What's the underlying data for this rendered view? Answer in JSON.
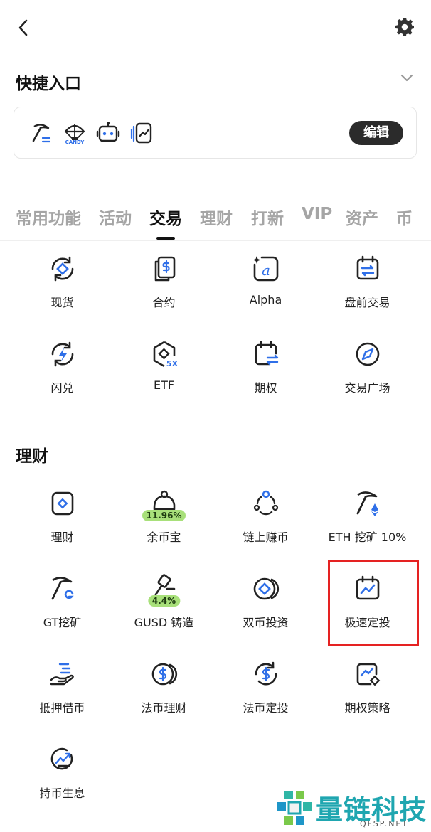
{
  "header": {
    "back_icon": "chevron-left-icon",
    "settings_icon": "gear-icon"
  },
  "quick_entry": {
    "title": "快捷入口",
    "icons": [
      "pickaxe-icon",
      "candy-parachute-icon",
      "robot-icon",
      "copy-trade-icon"
    ],
    "candy_label": "CANDY",
    "edit_label": "编辑"
  },
  "tabs": [
    {
      "label": "常用功能",
      "active": false
    },
    {
      "label": "活动",
      "active": false
    },
    {
      "label": "交易",
      "active": true
    },
    {
      "label": "理财",
      "active": false
    },
    {
      "label": "打新",
      "active": false
    },
    {
      "label": "VIP",
      "active": false
    },
    {
      "label": "资产",
      "active": false
    },
    {
      "label": "币",
      "active": false
    }
  ],
  "trade": {
    "items": [
      {
        "label": "现货",
        "icon": "spot-icon"
      },
      {
        "label": "合约",
        "icon": "futures-icon"
      },
      {
        "label": "Alpha",
        "icon": "alpha-icon"
      },
      {
        "label": "盘前交易",
        "icon": "premarket-icon"
      },
      {
        "label": "闪兑",
        "icon": "flash-swap-icon"
      },
      {
        "label": "ETF",
        "icon": "etf-icon"
      },
      {
        "label": "期权",
        "icon": "options-icon"
      },
      {
        "label": "交易广场",
        "icon": "compass-icon"
      }
    ]
  },
  "finance": {
    "title": "理财",
    "items": [
      {
        "label": "理财",
        "icon": "finance-icon"
      },
      {
        "label": "余币宝",
        "icon": "piggy-icon",
        "badge": "11.96%"
      },
      {
        "label": "链上赚币",
        "icon": "onchain-earn-icon"
      },
      {
        "label": "ETH 挖矿 10%",
        "icon": "eth-mining-icon"
      },
      {
        "label": "GT挖矿",
        "icon": "gt-mining-icon"
      },
      {
        "label": "GUSD 铸造",
        "icon": "gusd-mint-icon",
        "badge": "4.4%"
      },
      {
        "label": "双币投资",
        "icon": "dual-coin-icon"
      },
      {
        "label": "极速定投",
        "icon": "calendar-chart-icon"
      },
      {
        "label": "抵押借币",
        "icon": "collateral-loan-icon"
      },
      {
        "label": "法币理财",
        "icon": "fiat-finance-icon"
      },
      {
        "label": "法币定投",
        "icon": "fiat-auto-invest-icon"
      },
      {
        "label": "期权策略",
        "icon": "options-strategy-icon"
      },
      {
        "label": "持币生息",
        "icon": "hold-earn-icon"
      }
    ]
  },
  "watermark": {
    "text": "量链科技",
    "sub": "QFSP.NET"
  },
  "colors": {
    "accent": "#2f6fe8",
    "highlight": "#e52222",
    "badge": "#a8e07a"
  }
}
